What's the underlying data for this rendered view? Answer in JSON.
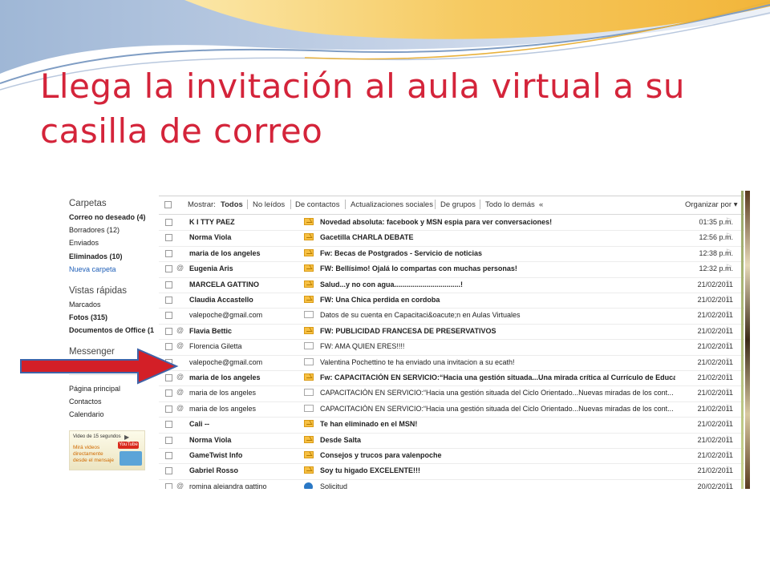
{
  "slide": {
    "title": "Llega la invitación al aula virtual a su casilla de correo"
  },
  "colors": {
    "title": "#d4243a",
    "arrow": "#d31f27",
    "link": "#1f5fb8"
  },
  "sidebar": {
    "carpetas_heading": "Carpetas",
    "folders": [
      {
        "label": "Correo no deseado (4)",
        "bold": true
      },
      {
        "label": "Borradores (12)",
        "bold": false
      },
      {
        "label": "Enviados",
        "bold": false
      },
      {
        "label": "Eliminados (10)",
        "bold": true
      },
      {
        "label": "Nueva carpeta",
        "link": true
      }
    ],
    "vistas_heading": "Vistas rápidas",
    "views": [
      {
        "label": "Marcados",
        "bold": false
      },
      {
        "label": "Fotos (315)",
        "bold": true
      },
      {
        "label": "Documentos de Office (1",
        "bold": true
      }
    ],
    "messenger_heading": "Messenger",
    "links": [
      "Página principal",
      "Contactos",
      "Calendario"
    ],
    "ad": {
      "line1": "Video de 15 segundos",
      "line2": "Mirá videos directamente desde el mensaje",
      "brand": "YouTube"
    }
  },
  "toolbar": {
    "show_label": "Mostrar:",
    "filters": [
      "Todos",
      "No leídos",
      "De contactos",
      "Actualizaciones sociales",
      "De grupos",
      "Todo lo demás",
      "«"
    ],
    "sort_label": "Organizar por ▾"
  },
  "messages": [
    {
      "sender": "K I TTY PAEZ",
      "subject": "Novedad absoluta: facebook y MSN espia para ver conversaciones!",
      "date": "01:35 p.m.",
      "unread": true,
      "clip": false,
      "icon": "envelope-unread"
    },
    {
      "sender": "Norma Viola",
      "subject": "Gacetilla CHARLA DEBATE",
      "date": "12:56 p.m.",
      "unread": true,
      "clip": false,
      "icon": "envelope-unread"
    },
    {
      "sender": "maria de los angeles",
      "subject": "Fw: Becas de Postgrados - Servicio de noticias",
      "date": "12:38 p.m.",
      "unread": true,
      "clip": false,
      "icon": "envelope-unread"
    },
    {
      "sender": "Eugenia Aris",
      "subject": "FW: Bellísimo! Ojalá lo compartas con muchas personas!",
      "date": "12:32 p.m.",
      "unread": true,
      "clip": true,
      "icon": "envelope-unread"
    },
    {
      "sender": "MARCELA GATTINO",
      "subject": "Salud...y no con agua.................................!",
      "date": "21/02/2011",
      "unread": true,
      "clip": false,
      "icon": "envelope-unread"
    },
    {
      "sender": "Claudia Accastello",
      "subject": "FW: Una Chica perdida en cordoba",
      "date": "21/02/2011",
      "unread": true,
      "clip": false,
      "icon": "envelope-unread"
    },
    {
      "sender": "valepoche@gmail.com",
      "subject": "Datos de su cuenta en Capacitaci&oacute;n en Aulas Virtuales",
      "date": "21/02/2011",
      "unread": false,
      "clip": false,
      "icon": "envelope-read"
    },
    {
      "sender": "Flavia Bettic",
      "subject": "FW: PUBLICIDAD FRANCESA DE PRESERVATIVOS",
      "date": "21/02/2011",
      "unread": true,
      "clip": true,
      "icon": "envelope-unread"
    },
    {
      "sender": "Florencia Giletta",
      "subject": "FW: AMA QUIEN ERES!!!!",
      "date": "21/02/2011",
      "unread": false,
      "clip": true,
      "icon": "envelope-read"
    },
    {
      "sender": "valepoche@gmail.com",
      "subject": "Valentina Pochettino te ha enviado una invitacion a su ecath!",
      "date": "21/02/2011",
      "unread": false,
      "clip": false,
      "icon": "envelope-read"
    },
    {
      "sender": "maria de los angeles",
      "subject": "Fw: CAPACITACIÓN EN SERVICIO:“Hacia una gestión situada...Una mirada crítica al Currículo de Educa...",
      "date": "21/02/2011",
      "unread": true,
      "clip": true,
      "icon": "envelope-unread"
    },
    {
      "sender": "maria de los angeles",
      "subject": "CAPACITACIÓN EN SERVICIO:“Hacia una gestión situada del Ciclo Orientado...Nuevas miradas de los cont...",
      "date": "21/02/2011",
      "unread": false,
      "clip": true,
      "icon": "envelope-read"
    },
    {
      "sender": "maria de los angeles",
      "subject": "CAPACITACIÓN EN SERVICIO:“Hacia una gestión situada del Ciclo Orientado...Nuevas miradas de los cont...",
      "date": "21/02/2011",
      "unread": false,
      "clip": true,
      "icon": "envelope-read"
    },
    {
      "sender": "Cali --",
      "subject": "Te han eliminado en el MSN!",
      "date": "21/02/2011",
      "unread": true,
      "clip": false,
      "icon": "envelope-unread"
    },
    {
      "sender": "Norma Viola",
      "subject": "Desde Salta",
      "date": "21/02/2011",
      "unread": true,
      "clip": false,
      "icon": "envelope-unread"
    },
    {
      "sender": "GameTwist Info",
      "subject": "Consejos y trucos para valenpoche",
      "date": "21/02/2011",
      "unread": true,
      "clip": false,
      "icon": "envelope-unread"
    },
    {
      "sender": "Gabriel Rosso",
      "subject": "Soy tu higado EXCELENTE!!!",
      "date": "21/02/2011",
      "unread": true,
      "clip": false,
      "icon": "envelope-unread"
    },
    {
      "sender": "romina alejandra gattino",
      "subject": "Solicitud",
      "date": "20/02/2011",
      "unread": false,
      "clip": true,
      "icon": "request-icon"
    }
  ]
}
